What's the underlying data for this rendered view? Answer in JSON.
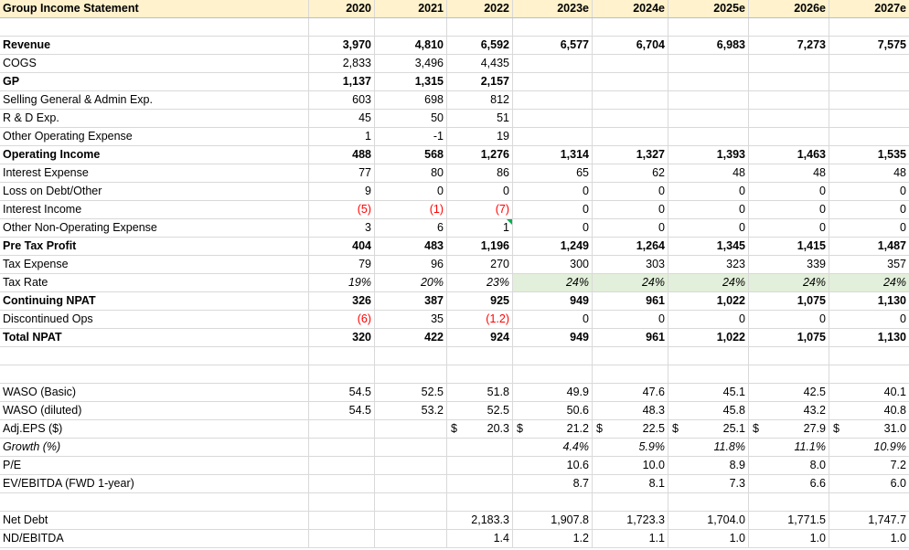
{
  "sheet": {
    "title": "Group Income Statement",
    "years": [
      "2020",
      "2021",
      "2022",
      "2023e",
      "2024e",
      "2025e",
      "2026e",
      "2027e"
    ],
    "rows": [
      {
        "label": "",
        "values": [
          "",
          "",
          "",
          "",
          "",
          "",
          "",
          ""
        ]
      },
      {
        "label": "Revenue",
        "bold": true,
        "values": [
          "3,970",
          "4,810",
          "6,592",
          "6,577",
          "6,704",
          "6,983",
          "7,273",
          "7,575"
        ]
      },
      {
        "label": "COGS",
        "values": [
          "2,833",
          "3,496",
          "4,435",
          "",
          "",
          "",
          "",
          ""
        ]
      },
      {
        "label": "GP",
        "bold": true,
        "values": [
          "1,137",
          "1,315",
          "2,157",
          "",
          "",
          "",
          "",
          ""
        ]
      },
      {
        "label": "Selling General & Admin Exp.",
        "values": [
          "603",
          "698",
          "812",
          "",
          "",
          "",
          "",
          ""
        ]
      },
      {
        "label": "R & D Exp.",
        "values": [
          "45",
          "50",
          "51",
          "",
          "",
          "",
          "",
          ""
        ]
      },
      {
        "label": "Other Operating Expense",
        "values": [
          "1",
          "-1",
          "19",
          "",
          "",
          "",
          "",
          ""
        ]
      },
      {
        "label": "Operating Income",
        "bold": true,
        "values": [
          "488",
          "568",
          "1,276",
          "1,314",
          "1,327",
          "1,393",
          "1,463",
          "1,535"
        ]
      },
      {
        "label": "Interest Expense",
        "values": [
          "77",
          "80",
          "86",
          "65",
          "62",
          "48",
          "48",
          "48"
        ]
      },
      {
        "label": "Loss on Debt/Other",
        "values": [
          "9",
          "0",
          "0",
          "0",
          "0",
          "0",
          "0",
          "0"
        ]
      },
      {
        "label": "Interest Income",
        "values": [
          "(5)",
          "(1)",
          "(7)",
          "0",
          "0",
          "0",
          "0",
          "0"
        ],
        "red": [
          0,
          1,
          2
        ]
      },
      {
        "label": "Other Non-Operating Expense",
        "values": [
          "3",
          "6",
          "1",
          "0",
          "0",
          "0",
          "0",
          "0"
        ],
        "marker": 2
      },
      {
        "label": "Pre Tax Profit",
        "bold": true,
        "values": [
          "404",
          "483",
          "1,196",
          "1,249",
          "1,264",
          "1,345",
          "1,415",
          "1,487"
        ]
      },
      {
        "label": "Tax Expense",
        "values": [
          "79",
          "96",
          "270",
          "300",
          "303",
          "323",
          "339",
          "357"
        ]
      },
      {
        "label": "Tax Rate",
        "italic": true,
        "values": [
          "19%",
          "20%",
          "23%",
          "24%",
          "24%",
          "24%",
          "24%",
          "24%"
        ],
        "green": [
          3,
          4,
          5,
          6,
          7
        ]
      },
      {
        "label": "Continuing NPAT",
        "bold": true,
        "values": [
          "326",
          "387",
          "925",
          "949",
          "961",
          "1,022",
          "1,075",
          "1,130"
        ]
      },
      {
        "label": "Discontinued Ops",
        "values": [
          "(6)",
          "35",
          "(1.2)",
          "0",
          "0",
          "0",
          "0",
          "0"
        ],
        "red": [
          0,
          2
        ]
      },
      {
        "label": "Total NPAT",
        "bold": true,
        "values": [
          "320",
          "422",
          "924",
          "949",
          "961",
          "1,022",
          "1,075",
          "1,130"
        ]
      },
      {
        "label": "",
        "values": [
          "",
          "",
          "",
          "",
          "",
          "",
          "",
          ""
        ]
      },
      {
        "label": "",
        "values": [
          "",
          "",
          "",
          "",
          "",
          "",
          "",
          ""
        ]
      },
      {
        "label": "WASO (Basic)",
        "values": [
          "54.5",
          "52.5",
          "51.8",
          "49.9",
          "47.6",
          "45.1",
          "42.5",
          "40.1"
        ]
      },
      {
        "label": "WASO (diluted)",
        "values": [
          "54.5",
          "53.2",
          "52.5",
          "50.6",
          "48.3",
          "45.8",
          "43.2",
          "40.8"
        ]
      },
      {
        "label": "Adj.EPS ($)",
        "values": [
          "",
          "",
          "20.3",
          "21.2",
          "22.5",
          "25.1",
          "27.9",
          "31.0"
        ],
        "dollar": "$",
        "dollarCols": [
          2,
          3,
          4,
          5,
          6,
          7
        ]
      },
      {
        "label": "Growth (%)",
        "italic": true,
        "labelItalic": true,
        "values": [
          "",
          "",
          "",
          "4.4%",
          "5.9%",
          "11.8%",
          "11.1%",
          "10.9%"
        ]
      },
      {
        "label": "P/E",
        "values": [
          "",
          "",
          "",
          "10.6",
          "10.0",
          "8.9",
          "8.0",
          "7.2"
        ]
      },
      {
        "label": "EV/EBITDA (FWD 1-year)",
        "values": [
          "",
          "",
          "",
          "8.7",
          "8.1",
          "7.3",
          "6.6",
          "6.0"
        ]
      },
      {
        "label": "",
        "values": [
          "",
          "",
          "",
          "",
          "",
          "",
          "",
          ""
        ]
      },
      {
        "label": "Net Debt",
        "values": [
          "",
          "",
          "2,183.3",
          "1,907.8",
          "1,723.3",
          "1,704.0",
          "1,771.5",
          "1,747.7"
        ]
      },
      {
        "label": "ND/EBITDA",
        "values": [
          "",
          "",
          "1.4",
          "1.2",
          "1.1",
          "1.0",
          "1.0",
          "1.0"
        ]
      }
    ]
  }
}
